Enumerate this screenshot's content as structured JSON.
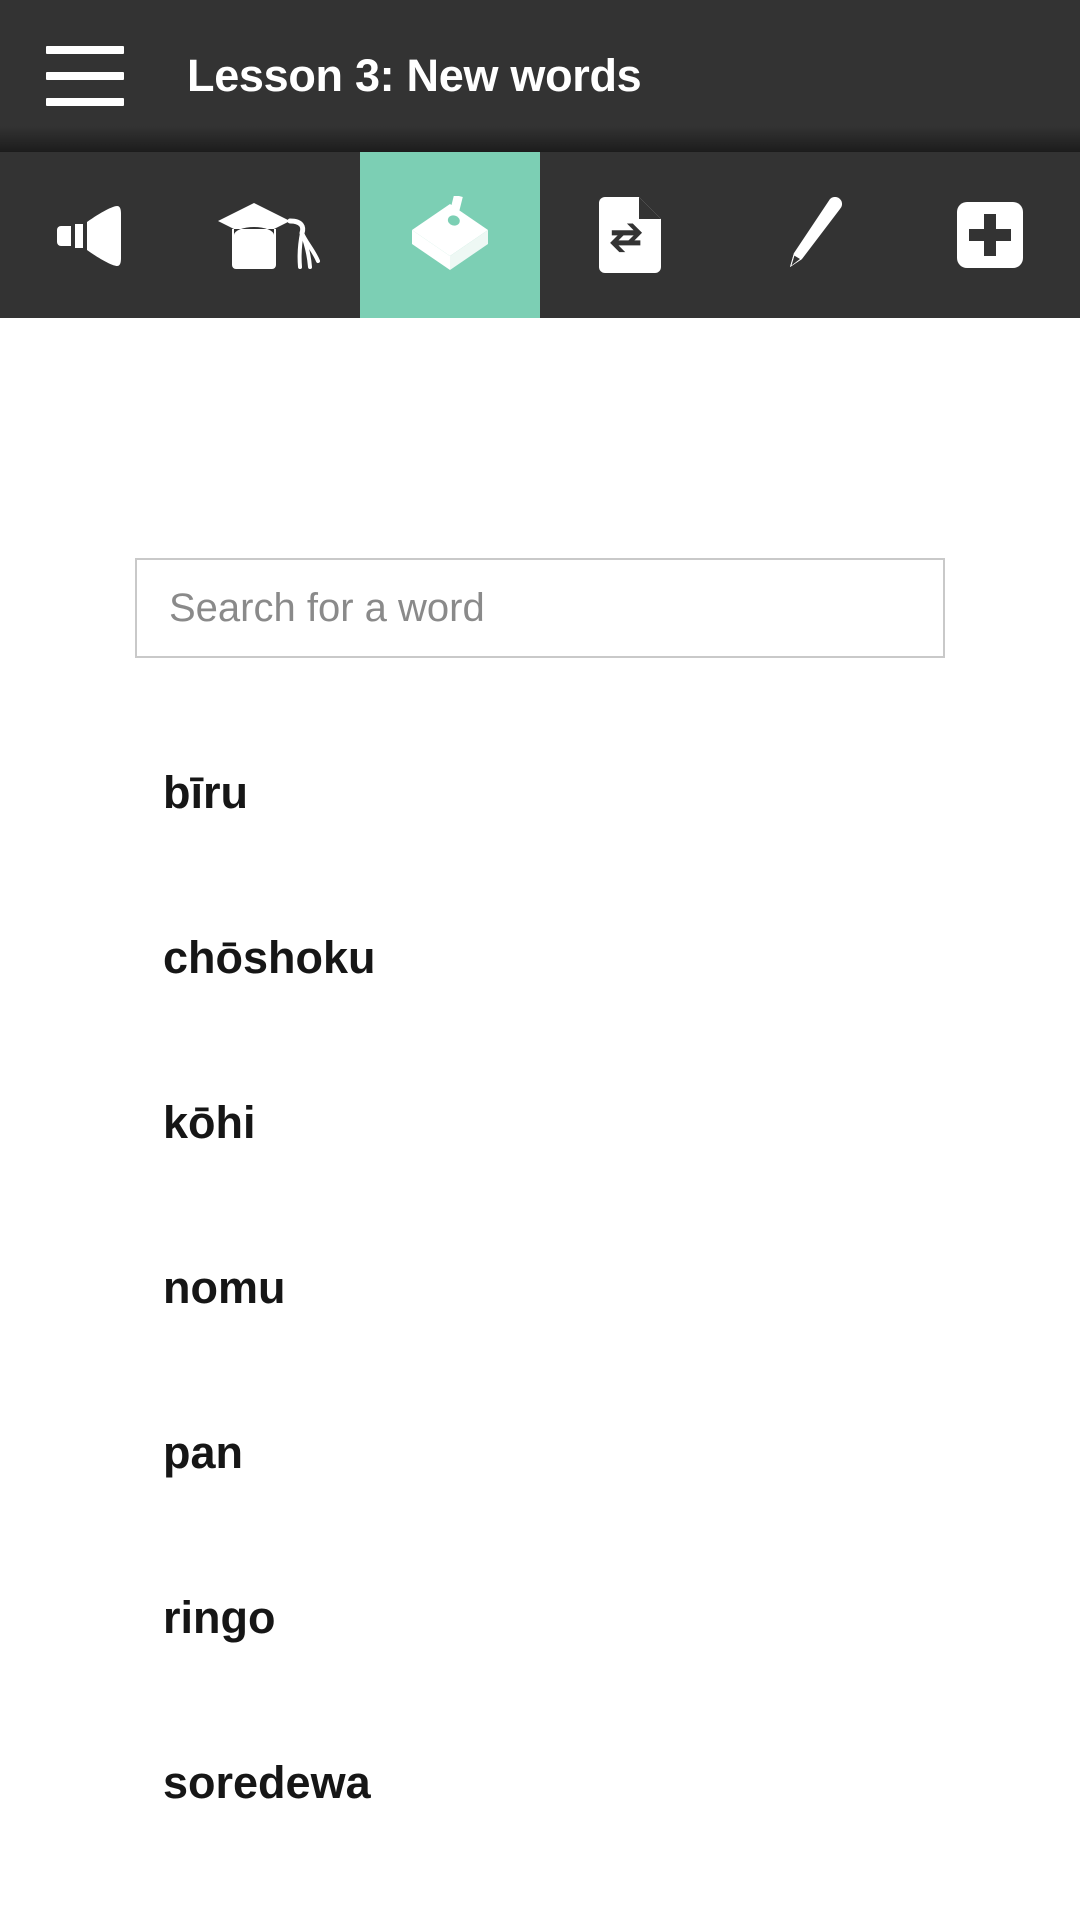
{
  "header": {
    "menu_icon": "hamburger-menu-icon",
    "title": "Lesson 3: New words"
  },
  "tabs": [
    {
      "id": "pronunciation",
      "icon": "megaphone-icon",
      "label": "Pronunciation",
      "active": false
    },
    {
      "id": "grammar",
      "icon": "graduation-cap-icon",
      "label": "Grammar",
      "active": false
    },
    {
      "id": "vocabulary",
      "icon": "word-box-icon",
      "label": "Vocabulary",
      "active": true
    },
    {
      "id": "translation",
      "icon": "document-exchange-icon",
      "label": "Translation",
      "active": false
    },
    {
      "id": "notes",
      "icon": "pencil-icon",
      "label": "Notes",
      "active": false
    },
    {
      "id": "add",
      "icon": "plus-square-icon",
      "label": "Add",
      "active": false
    }
  ],
  "search": {
    "placeholder": "Search for a word",
    "value": ""
  },
  "word_list": [
    {
      "word": "bīru"
    },
    {
      "word": "chōshoku"
    },
    {
      "word": "kōhi"
    },
    {
      "word": "nomu"
    },
    {
      "word": "pan"
    },
    {
      "word": "ringo"
    },
    {
      "word": "soredewa"
    }
  ],
  "colors": {
    "header_background": "#333333",
    "tabbar_background": "#333333",
    "active_tab": "#7ccfb4",
    "content_background": "#ffffff",
    "icon": "#ffffff",
    "title_text": "#ffffff",
    "word_text": "#161616",
    "placeholder_text": "#8a8a8a",
    "input_border": "#c9c9c9"
  }
}
